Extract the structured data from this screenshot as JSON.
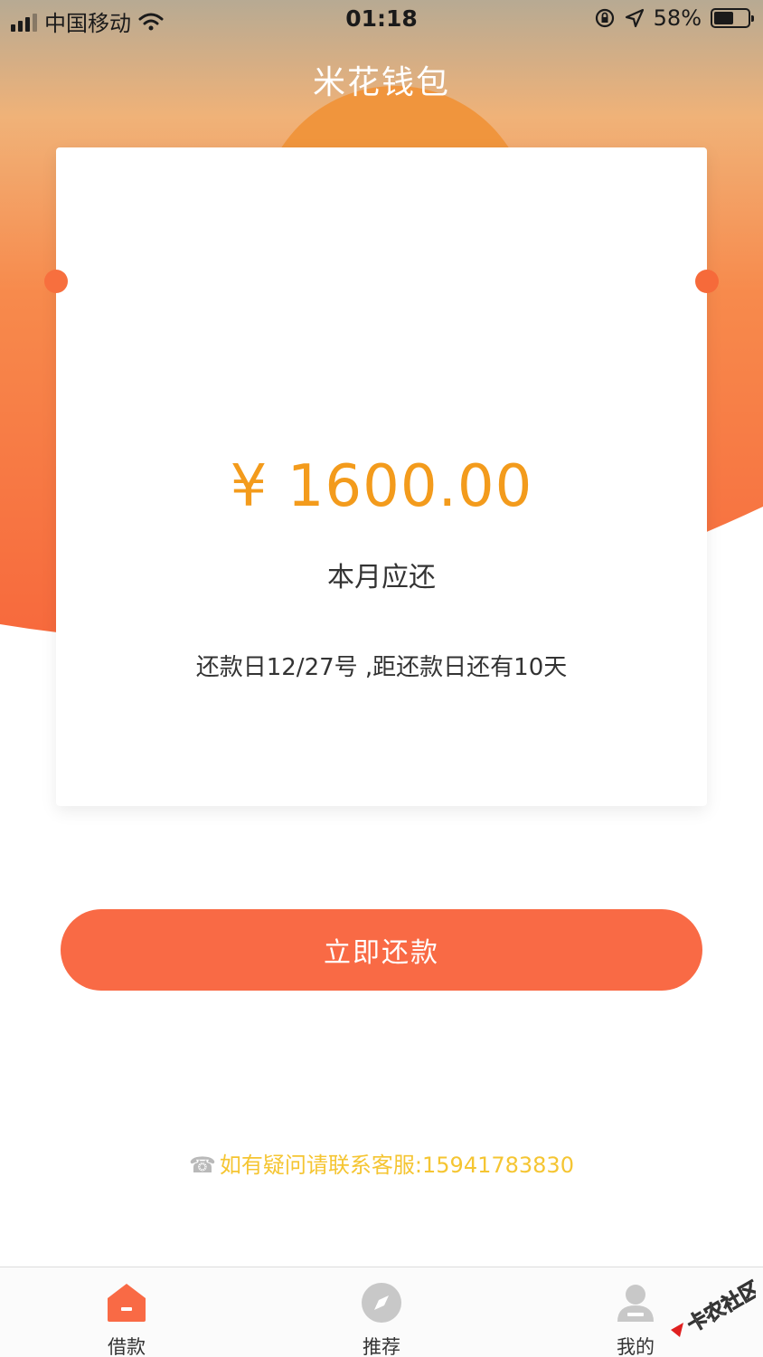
{
  "status_bar": {
    "carrier": "中国移动",
    "time": "01:18",
    "battery_percent": "58%",
    "battery_level": 0.58
  },
  "header": {
    "title": "米花钱包"
  },
  "card": {
    "amount": "¥ 1600.00",
    "amount_label": "本月应还",
    "due_info": "还款日12/27号 ,距还款日还有10天"
  },
  "repay_button": {
    "label": "立即还款"
  },
  "contact": {
    "text": "如有疑问请联系客服:15941783830"
  },
  "tab_bar": {
    "items": [
      {
        "label": "借款",
        "icon": "home-icon",
        "active": true
      },
      {
        "label": "推荐",
        "icon": "compass-icon",
        "active": false
      },
      {
        "label": "我的",
        "icon": "user-icon",
        "active": false
      }
    ]
  },
  "watermark": {
    "text": "卡农社区"
  },
  "colors": {
    "accent": "#f96a45",
    "amount": "#f39b1c",
    "contact": "#f5c532",
    "active_tab": "#f96a45",
    "inactive_tab": "#c8c8c8"
  }
}
